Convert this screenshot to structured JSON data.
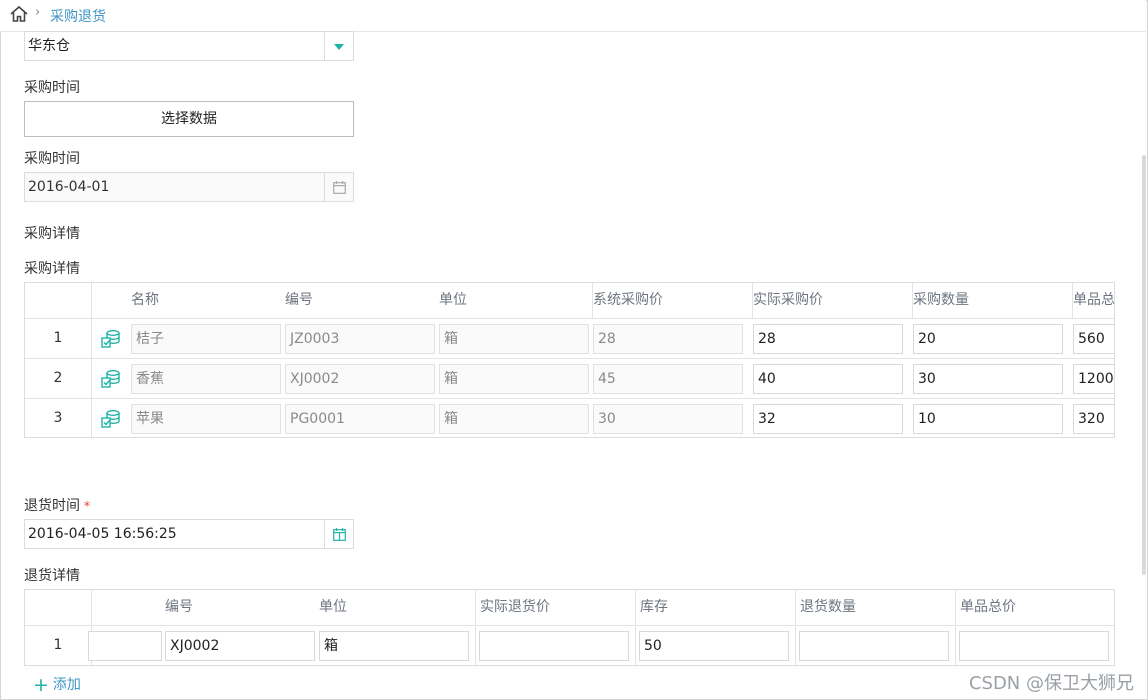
{
  "breadcrumb": {
    "home_icon": "home-icon",
    "separator": "›",
    "current": "采购退货"
  },
  "warehouse": {
    "value": "华东仓",
    "icon": "dropdown-caret-icon"
  },
  "purchase_time_label_1": "采购时间",
  "select_data_button": "选择数据",
  "purchase_time_label_2": "采购时间",
  "purchase_date": {
    "value": "2016-04-01",
    "icon": "calendar-icon"
  },
  "purchase_detail_heading": "采购详情",
  "purchase_detail_label": "采购详情",
  "purchase_table": {
    "headers": {
      "name": "名称",
      "code": "编号",
      "unit": "单位",
      "sys_price": "系统采购价",
      "actual_price": "实际采购价",
      "qty": "采购数量",
      "total": "单品总"
    },
    "rows": [
      {
        "index": "1",
        "name": "桔子",
        "code": "JZ0003",
        "unit": "箱",
        "sys_price": "28",
        "actual_price": "28",
        "qty": "20",
        "total": "560"
      },
      {
        "index": "2",
        "name": "香蕉",
        "code": "XJ0002",
        "unit": "箱",
        "sys_price": "45",
        "actual_price": "40",
        "qty": "30",
        "total": "1200"
      },
      {
        "index": "3",
        "name": "苹果",
        "code": "PG0001",
        "unit": "箱",
        "sys_price": "30",
        "actual_price": "32",
        "qty": "10",
        "total": "320"
      }
    ]
  },
  "return_time": {
    "label": "退货时间",
    "required": "*",
    "value": "2016-04-05 16:56:25",
    "icon": "calendar-icon"
  },
  "return_detail_label": "退货详情",
  "return_table": {
    "headers": {
      "code": "编号",
      "unit": "单位",
      "actual_return_price": "实际退货价",
      "stock": "库存",
      "return_qty": "退货数量",
      "total": "单品总价"
    },
    "rows": [
      {
        "index": "1",
        "name": "",
        "code": "XJ0002",
        "unit": "箱",
        "actual_return_price": "",
        "stock": "50",
        "return_qty": "",
        "total": ""
      }
    ]
  },
  "add_link": {
    "icon": "plus-icon",
    "label": "添加"
  },
  "watermark": "CSDN @保卫大狮兄",
  "colors": {
    "accent": "#1fb3a6",
    "link": "#3f96c6",
    "required": "#e33333"
  }
}
